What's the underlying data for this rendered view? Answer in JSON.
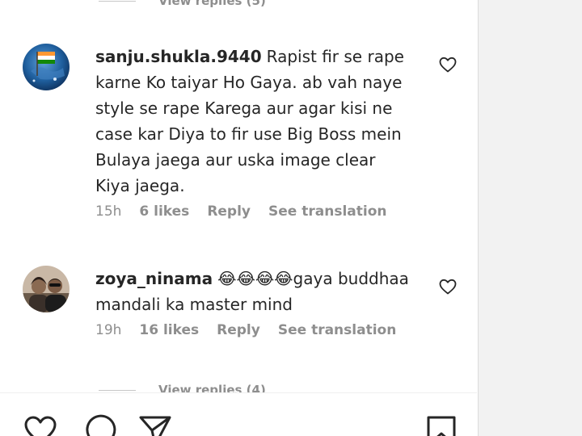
{
  "top_reply": {
    "label": "View replies (5)"
  },
  "comments": [
    {
      "username": "sanju.shukla.9440",
      "text": "Rapist fir se rape karne Ko taiyar Ho Gaya. ab vah naye style se rape Karega aur agar kisi ne case kar Diya to fir use Big Boss mein Bulaya jaega aur uska image clear Kiya jaega.",
      "time": "15h",
      "likes": "6 likes",
      "reply": "Reply",
      "translate": "See translation"
    },
    {
      "username": "zoya_ninama",
      "text": "😂😂😂😂gaya buddhaa mandali ka master mind",
      "time": "19h",
      "likes": "16 likes",
      "reply": "Reply",
      "translate": "See translation"
    }
  ],
  "bottom_reply": {
    "label": "View replies (4)"
  },
  "colors": {
    "text": "#262626",
    "muted": "#8e8e8e",
    "gutter": "#f2f2f2"
  },
  "icons": [
    "heart-icon",
    "comment-icon",
    "share-icon",
    "bookmark-icon"
  ]
}
